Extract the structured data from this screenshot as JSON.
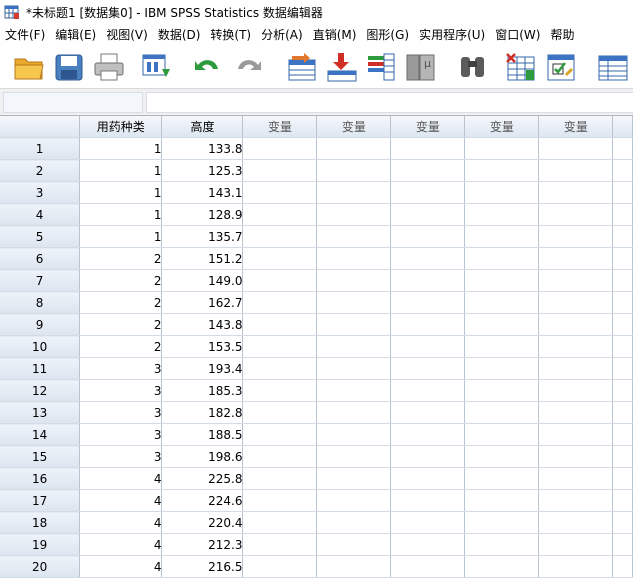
{
  "window": {
    "title": "*未标题1 [数据集0] - IBM SPSS Statistics 数据编辑器"
  },
  "menu": [
    "文件(F)",
    "编辑(E)",
    "视图(V)",
    "数据(D)",
    "转换(T)",
    "分析(A)",
    "直销(M)",
    "图形(G)",
    "实用程序(U)",
    "窗口(W)",
    "帮助"
  ],
  "toolbar": {
    "icons": [
      "open-folder-icon",
      "save-icon",
      "print-icon",
      "dialog-recall-icon",
      "undo-icon",
      "redo-icon",
      "goto-case-icon",
      "goto-variable-icon",
      "variables-icon",
      "run-descriptive-icon",
      "find-icon",
      "insert-cases-icon",
      "split-file-icon",
      "select-cases-icon",
      "value-labels-icon"
    ]
  },
  "editor": {
    "cell_reference": "",
    "cell_value": ""
  },
  "grid": {
    "columns": [
      "用药种类",
      "高度",
      "变量",
      "变量",
      "变量",
      "变量",
      "变量"
    ],
    "rows": [
      {
        "n": "1",
        "drug": "1",
        "height": "133.8"
      },
      {
        "n": "2",
        "drug": "1",
        "height": "125.3"
      },
      {
        "n": "3",
        "drug": "1",
        "height": "143.1"
      },
      {
        "n": "4",
        "drug": "1",
        "height": "128.9"
      },
      {
        "n": "5",
        "drug": "1",
        "height": "135.7"
      },
      {
        "n": "6",
        "drug": "2",
        "height": "151.2"
      },
      {
        "n": "7",
        "drug": "2",
        "height": "149.0"
      },
      {
        "n": "8",
        "drug": "2",
        "height": "162.7"
      },
      {
        "n": "9",
        "drug": "2",
        "height": "143.8"
      },
      {
        "n": "10",
        "drug": "2",
        "height": "153.5"
      },
      {
        "n": "11",
        "drug": "3",
        "height": "193.4"
      },
      {
        "n": "12",
        "drug": "3",
        "height": "185.3"
      },
      {
        "n": "13",
        "drug": "3",
        "height": "182.8"
      },
      {
        "n": "14",
        "drug": "3",
        "height": "188.5"
      },
      {
        "n": "15",
        "drug": "3",
        "height": "198.6"
      },
      {
        "n": "16",
        "drug": "4",
        "height": "225.8"
      },
      {
        "n": "17",
        "drug": "4",
        "height": "224.6"
      },
      {
        "n": "18",
        "drug": "4",
        "height": "220.4"
      },
      {
        "n": "19",
        "drug": "4",
        "height": "212.3"
      },
      {
        "n": "20",
        "drug": "4",
        "height": "216.5"
      }
    ]
  }
}
